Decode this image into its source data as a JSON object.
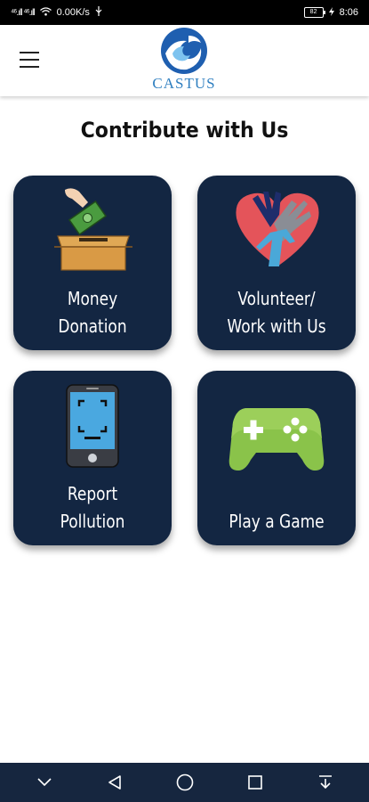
{
  "status_bar": {
    "signal_text": "⁴⁶.ıll ⁴⁶.ıll",
    "speed": "0.00K/s",
    "battery": "82",
    "time": "8:06"
  },
  "app": {
    "logo_text": "CASTUS",
    "title": "Contribute with Us"
  },
  "cards": {
    "money": {
      "line1": "Money",
      "line2": "Donation"
    },
    "volunteer": {
      "line1": "Volunteer/",
      "line2": "Work with Us"
    },
    "report": {
      "line1": "Report",
      "line2": "Pollution"
    },
    "game": {
      "line1": "Play a Game"
    }
  },
  "colors": {
    "card_bg": "#132642",
    "logo_blue": "#2f7fc0",
    "nav_bg": "#16263f"
  },
  "icons": {
    "menu": "hamburger-menu-icon",
    "money": "cash-donation-box-icon",
    "volunteer": "heart-hands-icon",
    "report": "phone-scan-icon",
    "game": "gamepad-icon"
  }
}
